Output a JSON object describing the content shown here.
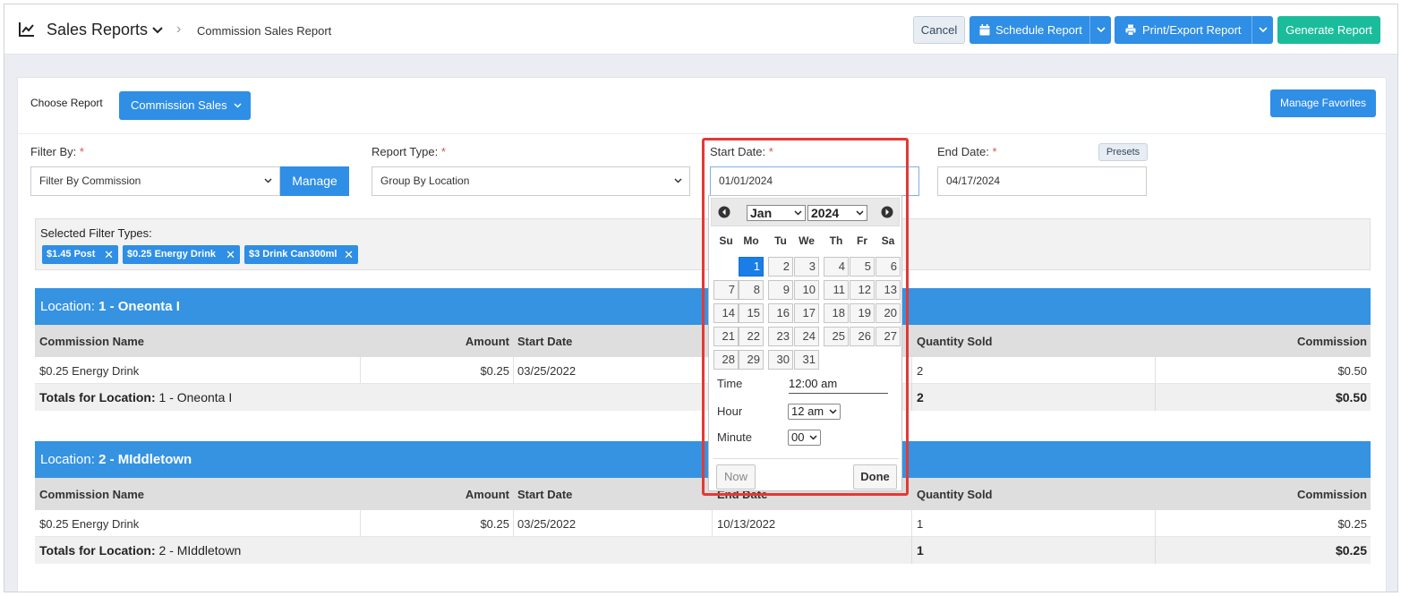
{
  "header": {
    "title": "Sales Reports",
    "breadcrumb_sep": "›",
    "breadcrumb": "Commission Sales Report",
    "cancel_label": "Cancel",
    "schedule_label": "Schedule Report",
    "print_label": "Print/Export Report",
    "generate_label": "Generate Report"
  },
  "toolbar": {
    "choose_label": "Choose Report",
    "commission_label": "Commission Sales",
    "favorites_label": "Manage Favorites"
  },
  "filters": {
    "filter_by_label": "Filter By:",
    "filter_by_value": "Filter By Commission",
    "manage_label": "Manage",
    "report_type_label": "Report Type:",
    "report_type_value": "Group By Location",
    "start_date_label": "Start Date:",
    "start_date_value": "01/01/2024",
    "end_date_label": "End Date:",
    "end_date_value": "04/17/2024",
    "presets_label": "Presets",
    "required_mark": "*"
  },
  "selected_filters": {
    "title": "Selected Filter Types:",
    "tags": [
      "$1.45 Post",
      "$0.25 Energy Drink",
      "$3 Drink Can300ml"
    ],
    "remove_glyph": "✕"
  },
  "columns": {
    "name": "Commission Name",
    "amount": "Amount",
    "start": "Start Date",
    "end": "End Date",
    "qty": "Quantity Sold",
    "commission": "Commission"
  },
  "locations": [
    {
      "prefix": "Location:",
      "name": "1 - Oneonta I",
      "row": {
        "name": "$0.25 Energy Drink",
        "amount": "$0.25",
        "start": "03/25/2022",
        "end": "",
        "qty": "2",
        "commission": "$0.50"
      },
      "total_label": "Totals for Location:",
      "total_name": "1 - Oneonta I",
      "total_qty": "2",
      "total_commission": "$0.50"
    },
    {
      "prefix": "Location:",
      "name": "2 - MIddletown",
      "row": {
        "name": "$0.25 Energy Drink",
        "amount": "$0.25",
        "start": "03/25/2022",
        "end": "10/13/2022",
        "qty": "1",
        "commission": "$0.25"
      },
      "total_label": "Totals for Location:",
      "total_name": "2 - MIddletown",
      "total_qty": "1",
      "total_commission": "$0.25"
    }
  ],
  "datepicker": {
    "month": "Jan",
    "year": "2024",
    "weekdays": [
      "Su",
      "Mo",
      "Tu",
      "We",
      "Th",
      "Fr",
      "Sa"
    ],
    "first_weekday_index": 1,
    "days_in_month": 31,
    "selected_day": 1,
    "time_label": "Time",
    "time_value": "12:00 am",
    "hour_label": "Hour",
    "hour_value": "12 am",
    "minute_label": "Minute",
    "minute_value": "00",
    "now_label": "Now",
    "done_label": "Done"
  },
  "colors": {
    "primary": "#2f8ee5",
    "success": "#1bbc9b",
    "banner": "#3593e2",
    "highlight": "#e53935"
  }
}
